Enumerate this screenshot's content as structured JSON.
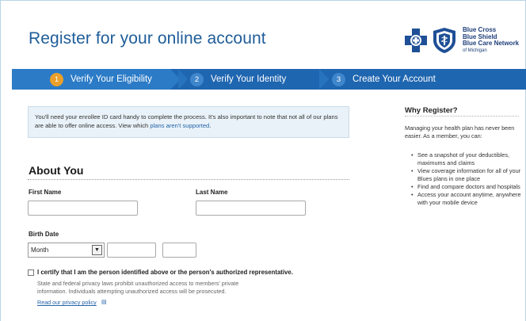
{
  "page_title": "Register for your online account",
  "logo": {
    "line1": "Blue Cross",
    "line2": "Blue Shield",
    "line3": "Blue Care Network",
    "line4": "of Michigan"
  },
  "steps": [
    {
      "number": "1",
      "label": "Verify Your Eligibility",
      "active": true
    },
    {
      "number": "2",
      "label": "Verify Your Identity",
      "active": false
    },
    {
      "number": "3",
      "label": "Create Your Account",
      "active": false
    }
  ],
  "notice": {
    "text_before": "You'll need your enrollee ID card handy to complete the process. It's also important to note that not all of our plans are able to offer online access. View which ",
    "link_text": "plans aren't supported",
    "text_after": "."
  },
  "about": {
    "title": "About You",
    "first_name_label": "First Name",
    "last_name_label": "Last Name",
    "birth_date_label": "Birth Date",
    "month_value": "Month"
  },
  "certify": {
    "label": "I certify that I am the person identified above or the person's authorized representative.",
    "privacy_text": "State and federal privacy laws prohibit unauthorized access to members' private information. Individuals attempting unauthorized access will be prosecuted.",
    "privacy_link": "Read our privacy policy"
  },
  "why": {
    "title": "Why Register?",
    "intro": "Managing your health plan has never been easier. As a member, you can:",
    "items": [
      "See a snapshot of your deductibles, maximums and claims",
      "View coverage information for all of your Blues plans in one place",
      "Find and compare doctors and hospitals",
      "Access your account anytime, anywhere with your mobile device"
    ]
  },
  "colors": {
    "brand_blue": "#1f5d99",
    "step_bar": "#1f66b0",
    "active_step_number": "#eaa02a"
  }
}
